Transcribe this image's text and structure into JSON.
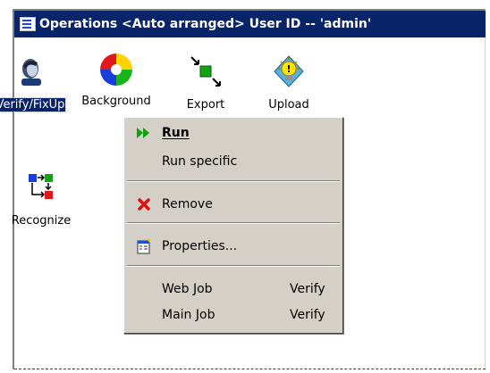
{
  "window": {
    "title": "Operations <Auto arranged>  User ID -- 'admin'",
    "title_bg": "#0a246a"
  },
  "operations": [
    {
      "label": "Verify/FixUp",
      "icon": "user-head-icon",
      "selected": true
    },
    {
      "label": "Background",
      "icon": "color-circle-icon",
      "selected": false
    },
    {
      "label": "Export",
      "icon": "export-arrows-icon",
      "selected": false
    },
    {
      "label": "Upload",
      "icon": "lightbulb-icon",
      "selected": false
    },
    {
      "label": "Recognize",
      "icon": "recognize-flow-icon",
      "selected": false
    }
  ],
  "context_menu": {
    "items": [
      {
        "label": "Run",
        "mnemonic": "R",
        "icon": "run-arrow-icon",
        "bold": true
      },
      {
        "label": "Run specific"
      },
      {
        "label": "Remove",
        "mnemonic": "v",
        "icon": "remove-x-icon"
      },
      {
        "label": "Properties...",
        "mnemonic": "P",
        "icon": "properties-icon"
      },
      {
        "label": "Web Job",
        "value": "Verify"
      },
      {
        "label": "Main Job",
        "value": "Verify"
      }
    ]
  }
}
